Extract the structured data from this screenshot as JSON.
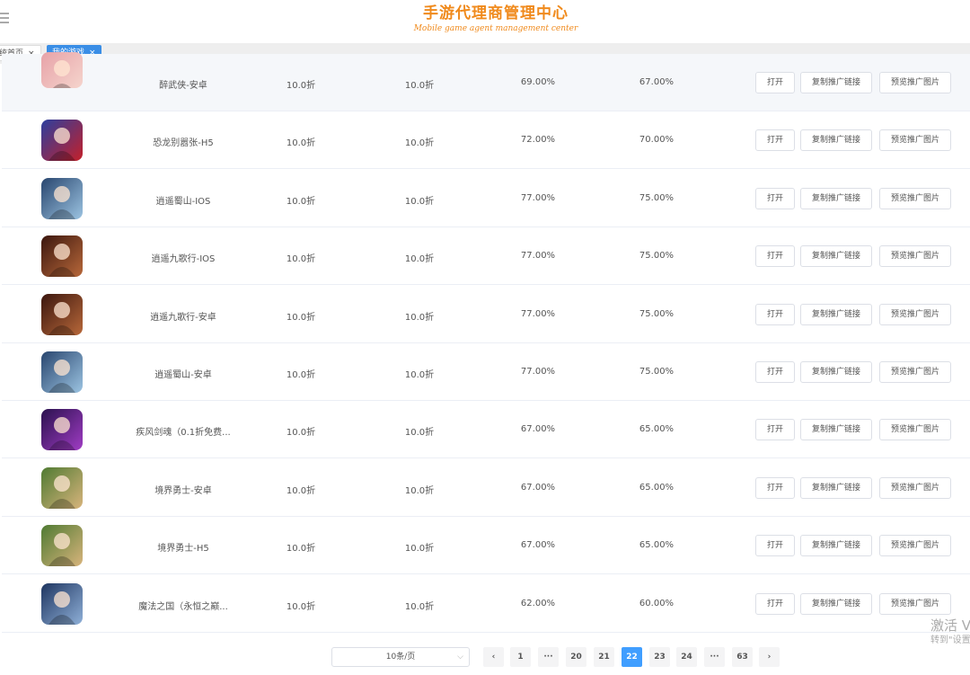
{
  "header": {
    "title": "手游代理商管理中心",
    "subtitle": "Mobile game agent management center"
  },
  "tabs": [
    {
      "label": "统首页",
      "close": "×"
    },
    {
      "label": "我的游戏",
      "close": "×"
    }
  ],
  "buttons": {
    "open": "打开",
    "copy": "复制推广链接",
    "preview": "预览推广图片"
  },
  "games": [
    {
      "name": "醉武侠-安卓",
      "discount1": "10.0折",
      "discount2": "10.0折",
      "pct1": "69.00%",
      "pct2": "67.00%",
      "icon": "swordswoman-portrait-icon",
      "c1": "#e7a2a8",
      "c2": "#f6d8cf"
    },
    {
      "name": "恐龙别嚣张-H5",
      "discount1": "10.0折",
      "discount2": "10.0折",
      "pct1": "72.00%",
      "pct2": "70.00%",
      "icon": "dinosaur-shield-icon",
      "c1": "#2c3f9e",
      "c2": "#c4202a"
    },
    {
      "name": "逍遥蜀山-IOS",
      "discount1": "10.0折",
      "discount2": "10.0折",
      "pct1": "77.00%",
      "pct2": "75.00%",
      "icon": "fairy-portrait-icon",
      "c1": "#28456e",
      "c2": "#9cc4e2"
    },
    {
      "name": "逍遥九歌行-IOS",
      "discount1": "10.0折",
      "discount2": "10.0折",
      "pct1": "77.00%",
      "pct2": "75.00%",
      "icon": "warrior-portrait-icon",
      "c1": "#3b160e",
      "c2": "#b8683a"
    },
    {
      "name": "逍遥九歌行-安卓",
      "discount1": "10.0折",
      "discount2": "10.0折",
      "pct1": "77.00%",
      "pct2": "75.00%",
      "icon": "warrior-portrait-icon",
      "c1": "#3b160e",
      "c2": "#b8683a"
    },
    {
      "name": "逍遥蜀山-安卓",
      "discount1": "10.0折",
      "discount2": "10.0折",
      "pct1": "77.00%",
      "pct2": "75.00%",
      "icon": "fairy-portrait-icon",
      "c1": "#28456e",
      "c2": "#9cc4e2"
    },
    {
      "name": "疾风剑魂（0.1折免费...",
      "discount1": "10.0折",
      "discount2": "10.0折",
      "pct1": "67.00%",
      "pct2": "65.00%",
      "icon": "demon-portrait-icon",
      "c1": "#2a114e",
      "c2": "#a03cc4"
    },
    {
      "name": "境界勇士-安卓",
      "discount1": "10.0折",
      "discount2": "10.0折",
      "pct1": "67.00%",
      "pct2": "65.00%",
      "icon": "hero-portrait-icon",
      "c1": "#4f7a32",
      "c2": "#d8b47c"
    },
    {
      "name": "境界勇士-H5",
      "discount1": "10.0折",
      "discount2": "10.0折",
      "pct1": "67.00%",
      "pct2": "65.00%",
      "icon": "hero-portrait-icon",
      "c1": "#4f7a32",
      "c2": "#d8b47c"
    },
    {
      "name": "魔法之国（永恒之巅...",
      "discount1": "10.0折",
      "discount2": "10.0折",
      "pct1": "62.00%",
      "pct2": "60.00%",
      "icon": "knight-portrait-icon",
      "c1": "#1e3560",
      "c2": "#8fb0d8"
    }
  ],
  "pagination": {
    "page_size": "10条/页",
    "pages": [
      "1",
      "···",
      "20",
      "21",
      "22",
      "23",
      "24",
      "···",
      "63"
    ],
    "active": "22",
    "prev": "‹",
    "next": "›",
    "dropdown_arrow": "⌵"
  },
  "watermark": {
    "line1": "激活 V",
    "line2": "转到\"设置"
  }
}
